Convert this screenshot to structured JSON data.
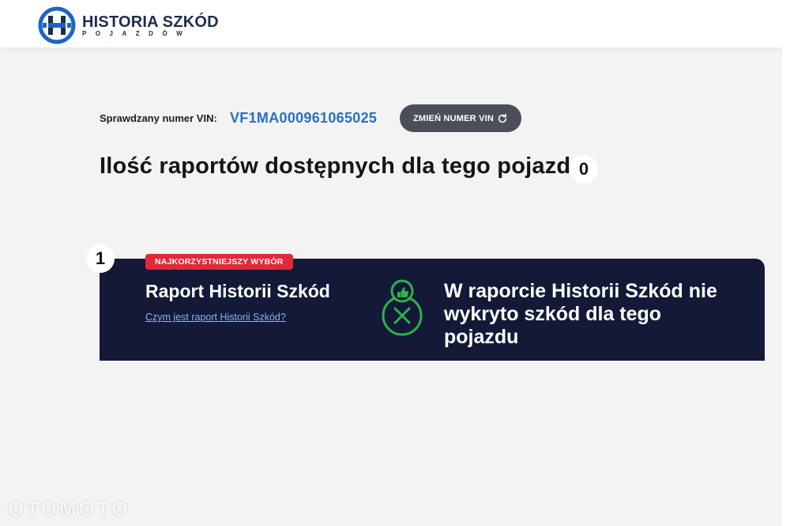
{
  "header": {
    "logo_title": "HISTORIA SZKÓD",
    "logo_subtitle": "POJAZDÓW"
  },
  "vin": {
    "label": "Sprawdzany numer VIN:",
    "value": "VF1MA000961065025",
    "change_button": "ZMIEŃ NUMER VIN"
  },
  "reports": {
    "title": "Ilość raportów dostępnych dla tego pojazdu",
    "count": "0"
  },
  "offer": {
    "step": "1",
    "badge": "NAJKORZYSTNIEJSZY WYBÓR",
    "title": "Raport Historii Szkód",
    "link": "Czym jest raport Historii Szkód?",
    "result": "W raporcie Historii Szkód nie wykryto szkód dla tego pojazdu"
  },
  "watermark": "OTOMOTO",
  "colors": {
    "brand": "#1d64c8",
    "card_bg": "#131937",
    "badge_red": "#e02a3a",
    "result_green": "#2bb24c"
  }
}
